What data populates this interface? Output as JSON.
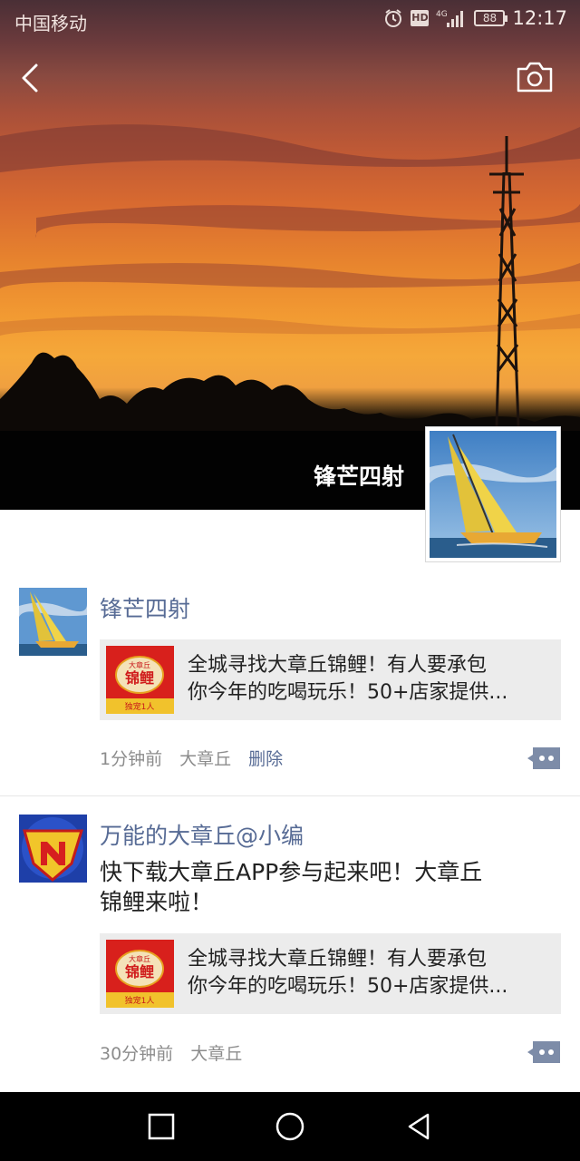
{
  "status_bar": {
    "carrier": "中国移动",
    "hd": "HD",
    "network": "4G",
    "battery": "88",
    "time": "12:17"
  },
  "header": {
    "back_icon": "chevron-left-icon",
    "camera_icon": "camera-icon"
  },
  "profile": {
    "name": "锋芒四射"
  },
  "posts": [
    {
      "author": "锋芒四射",
      "text": "",
      "share": {
        "thumb_top": "大章丘",
        "thumb_main": "锦鲤",
        "thumb_bottom": "独宠1人",
        "line1": "全城寻找大章丘锦鲤！有人要承包",
        "line2": "你今年的吃喝玩乐！50+店家提供..."
      },
      "time": "1分钟前",
      "location": "大章丘",
      "delete": "删除"
    },
    {
      "author": "万能的大章丘@小编",
      "text_line1": "快下载大章丘APP参与起来吧！大章丘",
      "text_line2": "锦鲤来啦！",
      "share": {
        "thumb_top": "大章丘",
        "thumb_main": "锦鲤",
        "thumb_bottom": "独宠1人",
        "line1": "全城寻找大章丘锦鲤！有人要承包",
        "line2": "你今年的吃喝玩乐！50+店家提供..."
      },
      "time": "30分钟前",
      "location": "大章丘"
    }
  ],
  "nav": {
    "recent_icon": "square-icon",
    "home_icon": "circle-icon",
    "back_icon": "triangle-back-icon"
  }
}
